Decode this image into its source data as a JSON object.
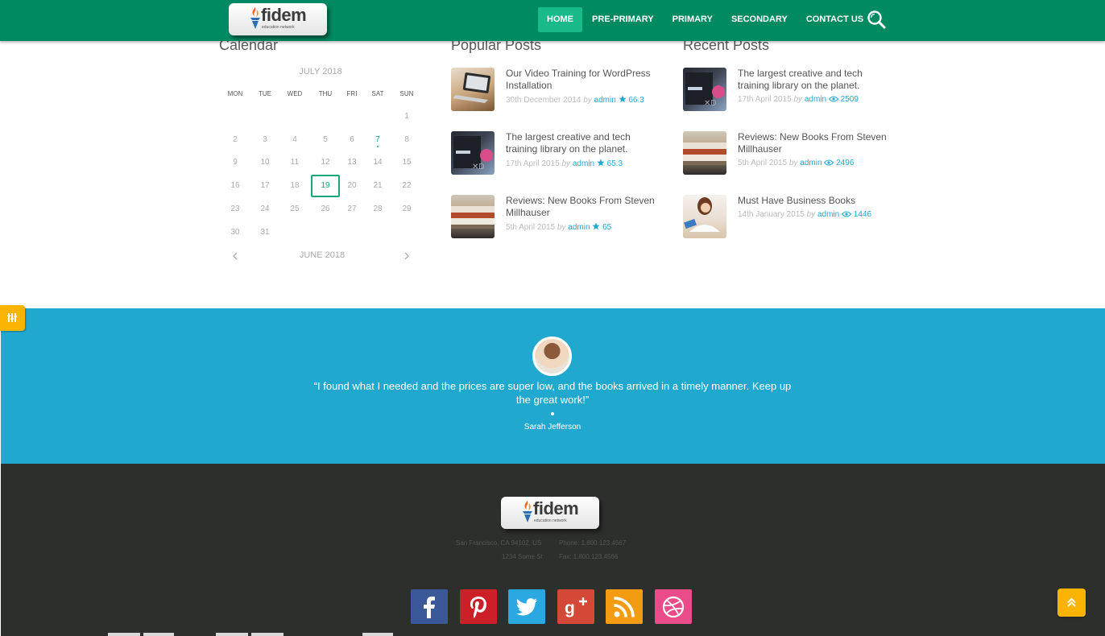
{
  "brand": {
    "name": "fidem",
    "tagline": "education network"
  },
  "nav": {
    "items": [
      "HOME",
      "PRE-PRIMARY",
      "PRIMARY",
      "SECONDARY",
      "CONTACT US"
    ],
    "active": "HOME",
    "search_icon": "search-icon"
  },
  "calendar": {
    "title": "Calendar",
    "month": "JULY 2018",
    "weekdays": [
      "MON",
      "TUE",
      "WED",
      "THU",
      "FRI",
      "SAT",
      "SUN"
    ],
    "days": [
      "1",
      "2",
      "3",
      "4",
      "5",
      "6",
      "7",
      "8",
      "9",
      "10",
      "11",
      "12",
      "13",
      "14",
      "15",
      "16",
      "17",
      "18",
      "19",
      "20",
      "21",
      "22",
      "23",
      "24",
      "25",
      "26",
      "27",
      "28",
      "29",
      "30",
      "31"
    ],
    "event_day": "7",
    "today": "19",
    "prev_month": "JUNE 2018",
    "prev_icon": "chevron-left-icon",
    "next_icon": "chevron-right-icon"
  },
  "popular": {
    "title": "Popular Posts",
    "posts": [
      {
        "title": "Our Video Training for WordPress Installation",
        "date": "30th December 2014",
        "by": "by",
        "author": "admin",
        "stat": "66.3",
        "stat_icon": "star-icon",
        "thumb": "laptop"
      },
      {
        "title": "The largest creative and tech training library on the planet.",
        "date": "17th April 2015",
        "by": "by",
        "author": "admin",
        "stat": "65.3",
        "stat_icon": "star-icon",
        "thumb": "video"
      },
      {
        "title": "Reviews: New Books From Steven Millhauser",
        "date": "5th April 2015",
        "by": "by",
        "author": "admin",
        "stat": "65",
        "stat_icon": "star-icon",
        "thumb": "books"
      }
    ]
  },
  "recent": {
    "title": "Recent Posts",
    "posts": [
      {
        "title": "The largest creative and tech training library on the planet.",
        "date": "17th April 2015",
        "by": "by",
        "author": "admin",
        "stat": "2509",
        "stat_icon": "eye-icon",
        "thumb": "video"
      },
      {
        "title": "Reviews: New Books From Steven Millhauser",
        "date": "5th April 2015",
        "by": "by",
        "author": "admin",
        "stat": "2496",
        "stat_icon": "eye-icon",
        "thumb": "books"
      },
      {
        "title": "Must Have Business Books",
        "date": "14th January 2015",
        "by": "by",
        "author": "admin",
        "stat": "1446",
        "stat_icon": "eye-icon",
        "thumb": "woman"
      }
    ]
  },
  "testimonial": {
    "quote": "“I found what I needed and the prices are super low, and the books arrived in a timely manner. Keep up the great work!”",
    "author": "Sarah Jefferson"
  },
  "footer": {
    "address_line1": "San Francisco, CA 94102, US",
    "address_line2": "1234 Some St",
    "phone": "Phone: 1.800.123.4567",
    "fax": "Fax: 1.800.123.4566",
    "social": [
      "facebook-icon",
      "pinterest-icon",
      "twitter-icon",
      "google-plus-icon",
      "rss-icon",
      "dribbble-icon"
    ]
  },
  "colors": {
    "header": "#008a62",
    "accent": "#19b98a",
    "link": "#21a8cf",
    "testimonial_bg": "#21a8cf",
    "footer_bg": "#2d2f2c",
    "gold": "#f8b400"
  }
}
